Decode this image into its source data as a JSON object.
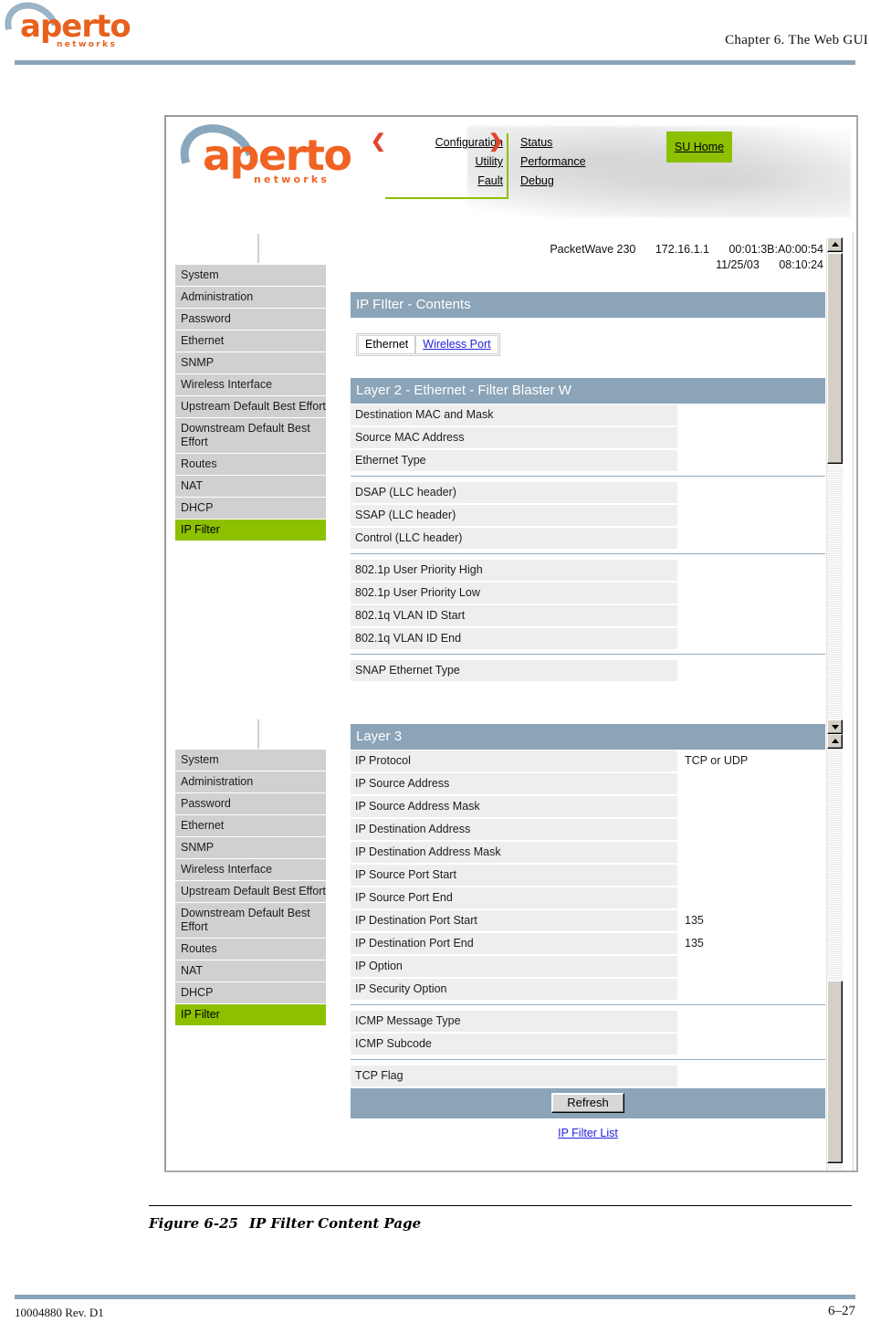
{
  "document": {
    "chapter_header": "Chapter 6.  The Web GUI",
    "brand_word": "aperto",
    "brand_sub": "networks",
    "figure_number": "Figure 6-25",
    "figure_title": "IP Filter Content Page",
    "footer_left": "10004880 Rev. D1",
    "footer_right": "6–27"
  },
  "screenshot": {
    "banner": {
      "brand_word": "aperto",
      "brand_sub": "networks",
      "nav_primary": [
        "Configuration",
        "Utility",
        "Fault"
      ],
      "nav_secondary": [
        "Status",
        "Performance",
        "Debug"
      ],
      "bracket_left": "❮",
      "bracket_right": "❯",
      "home_button": "SU Home"
    },
    "device_info": {
      "model": "PacketWave 230",
      "ip_address": "172.16.1.1",
      "mac_address": "00:01:3B:A0:00:54",
      "date": "11/25/03",
      "time": "08:10:24"
    },
    "page_title": "IP FIlter - Contents",
    "tabs": [
      {
        "label": "Ethernet",
        "selected": true
      },
      {
        "label": "Wireless Port",
        "selected": false
      }
    ],
    "sidebar": {
      "items": [
        {
          "label": "System",
          "active": false
        },
        {
          "label": "Administration",
          "active": false
        },
        {
          "label": "Password",
          "active": false
        },
        {
          "label": "Ethernet",
          "active": false
        },
        {
          "label": "SNMP",
          "active": false
        },
        {
          "label": "Wireless Interface",
          "active": false
        },
        {
          "label": "Upstream Default Best Effort",
          "active": false
        },
        {
          "label": "Downstream Default Best Effort",
          "active": false
        },
        {
          "label": "Routes",
          "active": false
        },
        {
          "label": "NAT",
          "active": false
        },
        {
          "label": "DHCP",
          "active": false
        },
        {
          "label": "IP Filter",
          "active": true
        }
      ]
    },
    "layer2": {
      "heading": "Layer 2 - Ethernet - Filter Blaster W",
      "groups": [
        [
          {
            "label": "Destination MAC and Mask",
            "value": ""
          },
          {
            "label": "Source MAC Address",
            "value": ""
          },
          {
            "label": "Ethernet Type",
            "value": ""
          }
        ],
        [
          {
            "label": "DSAP (LLC header)",
            "value": ""
          },
          {
            "label": "SSAP (LLC header)",
            "value": ""
          },
          {
            "label": "Control (LLC header)",
            "value": ""
          }
        ],
        [
          {
            "label": "802.1p User Priority High",
            "value": ""
          },
          {
            "label": "802.1p User Priority Low",
            "value": ""
          },
          {
            "label": "802.1q VLAN ID Start",
            "value": ""
          },
          {
            "label": "802.1q VLAN ID End",
            "value": ""
          }
        ],
        [
          {
            "label": "SNAP Ethernet Type",
            "value": ""
          }
        ]
      ]
    },
    "layer3": {
      "heading": "Layer 3",
      "groups": [
        [
          {
            "label": "IP Protocol",
            "value": "TCP or UDP"
          },
          {
            "label": "IP Source Address",
            "value": ""
          },
          {
            "label": "IP Source Address Mask",
            "value": ""
          },
          {
            "label": "IP Destination Address",
            "value": ""
          },
          {
            "label": "IP Destination Address Mask",
            "value": ""
          },
          {
            "label": "IP Source Port Start",
            "value": ""
          },
          {
            "label": "IP Source Port End",
            "value": ""
          },
          {
            "label": "IP Destination Port Start",
            "value": "135"
          },
          {
            "label": "IP Destination Port End",
            "value": "135"
          },
          {
            "label": "IP Option",
            "value": ""
          },
          {
            "label": "IP Security Option",
            "value": ""
          }
        ],
        [
          {
            "label": "ICMP Message Type",
            "value": ""
          },
          {
            "label": "ICMP Subcode",
            "value": ""
          }
        ],
        [
          {
            "label": "TCP Flag",
            "value": ""
          }
        ]
      ]
    },
    "refresh_button": "Refresh",
    "list_link": "IP Filter List"
  },
  "colors": {
    "accent_green": "#8dc000",
    "section_header": "#8ba4b8",
    "brand_orange": "#f06322",
    "link_blue": "#2222dd",
    "row_gray": "#eeeeee",
    "sidebar_gray": "#d0d0d0"
  }
}
